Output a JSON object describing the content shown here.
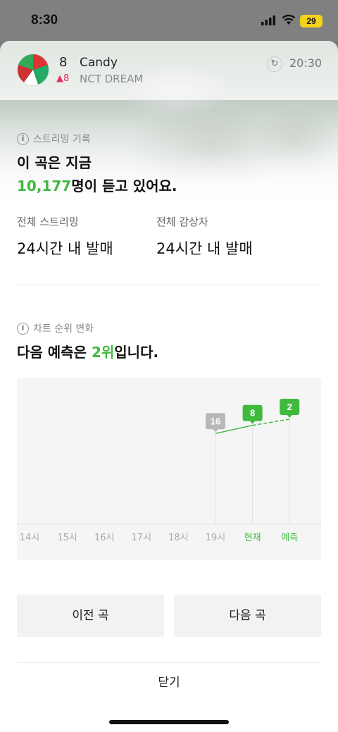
{
  "status_bar": {
    "time": "8:30",
    "battery": "29"
  },
  "song": {
    "rank": "8",
    "delta": "▲8",
    "title": "Candy",
    "artist": "NCT DREAM",
    "time": "20:30"
  },
  "streaming": {
    "label": "스트리밍 기록",
    "line1": "이 곡은 지금",
    "count": "10,177",
    "line2_suffix": "명이 듣고 있어요.",
    "total_label": "전체 스트리밍",
    "total_value": "24시간 내 발매",
    "listeners_label": "전체 감상자",
    "listeners_value": "24시간 내 발매"
  },
  "rank_change": {
    "label": "차트 순위 변화",
    "prefix": "다음 예측은 ",
    "rank": "2위",
    "suffix": "입니다."
  },
  "chart_data": {
    "type": "line",
    "categories": [
      "14시",
      "15시",
      "16시",
      "17시",
      "18시",
      "19시",
      "현재",
      "예측"
    ],
    "series": [
      {
        "values": [
          null,
          null,
          null,
          null,
          null,
          16,
          8,
          2
        ]
      }
    ],
    "highlight_categories": [
      "현재",
      "예측"
    ],
    "colors": {
      "accent": "#3fba3f",
      "past": "#b8b8b8"
    },
    "y_axis_inverted": true
  },
  "buttons": {
    "prev": "이전 곡",
    "next": "다음 곡",
    "close": "닫기"
  }
}
